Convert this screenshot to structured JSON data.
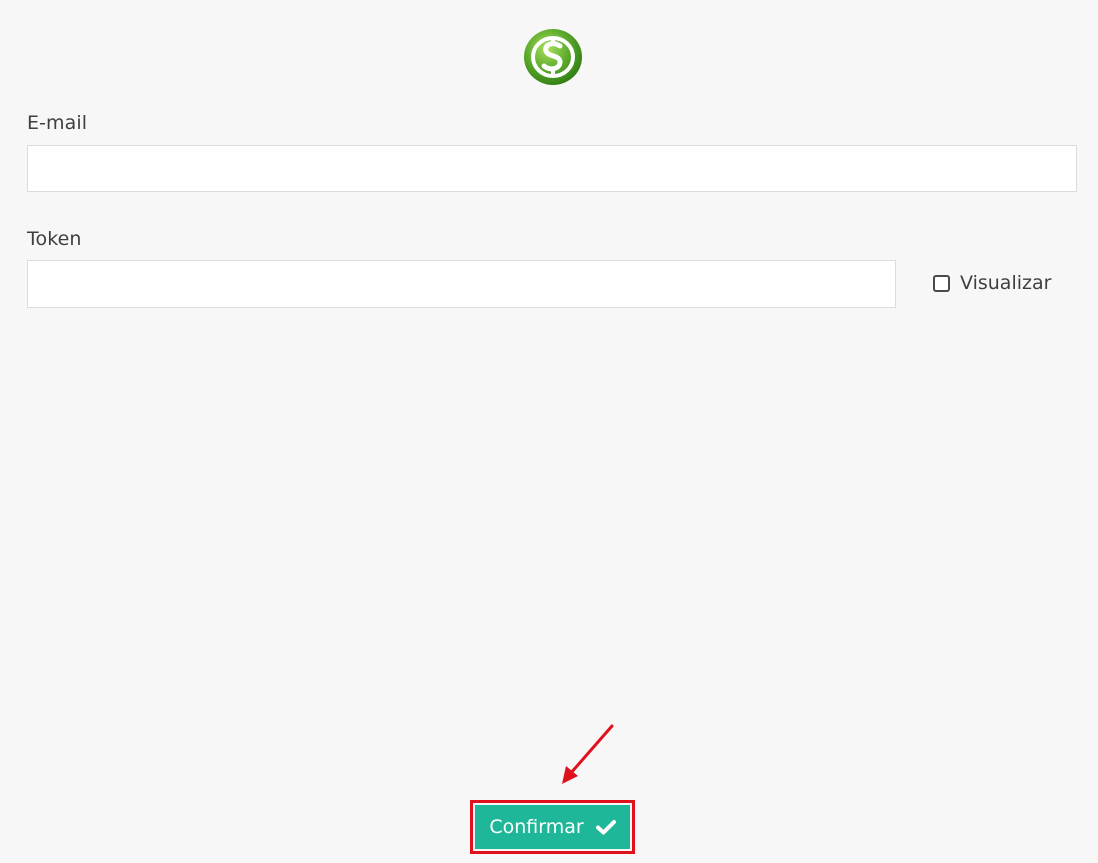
{
  "form": {
    "email": {
      "label": "E-mail",
      "value": "",
      "placeholder": ""
    },
    "token": {
      "label": "Token",
      "value": "",
      "placeholder": ""
    },
    "show_token": {
      "label": "Visualizar",
      "checked": false
    },
    "submit": {
      "label": "Confirmar",
      "icon": "check-icon"
    }
  },
  "logo": {
    "icon": "dollar-coin-logo"
  },
  "colors": {
    "background": "#f7f7f7",
    "button": "#1fb799",
    "highlight": "#e0101c",
    "logo_green": "#5aa82b"
  }
}
